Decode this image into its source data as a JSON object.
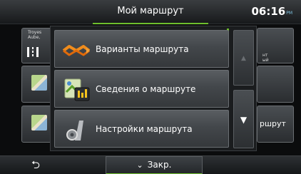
{
  "header": {
    "title": "Мой маршрут",
    "time": "06:16",
    "ampm": "PM"
  },
  "background": {
    "tile1_text_line1": "Troyes",
    "tile1_text_line2": "Aube, ",
    "right_tile1_text_line1": "нт",
    "right_tile1_text_line2": "ый",
    "right_tile3_label": "ршрут"
  },
  "menu": {
    "items": [
      {
        "label": "Варианты маршрута",
        "icon": "route-options-icon"
      },
      {
        "label": "Сведения о маршруте",
        "icon": "route-info-icon"
      },
      {
        "label": "Настройки маршрута",
        "icon": "route-settings-icon"
      }
    ],
    "scroll_up_icon": "▲",
    "scroll_down_icon": "▼"
  },
  "footer": {
    "back_icon": "⮌",
    "close_label": "Закр.",
    "close_icon": "⌄"
  },
  "colors": {
    "accent": "#6fbf2d",
    "clock_ampm": "#7fc6e8"
  }
}
